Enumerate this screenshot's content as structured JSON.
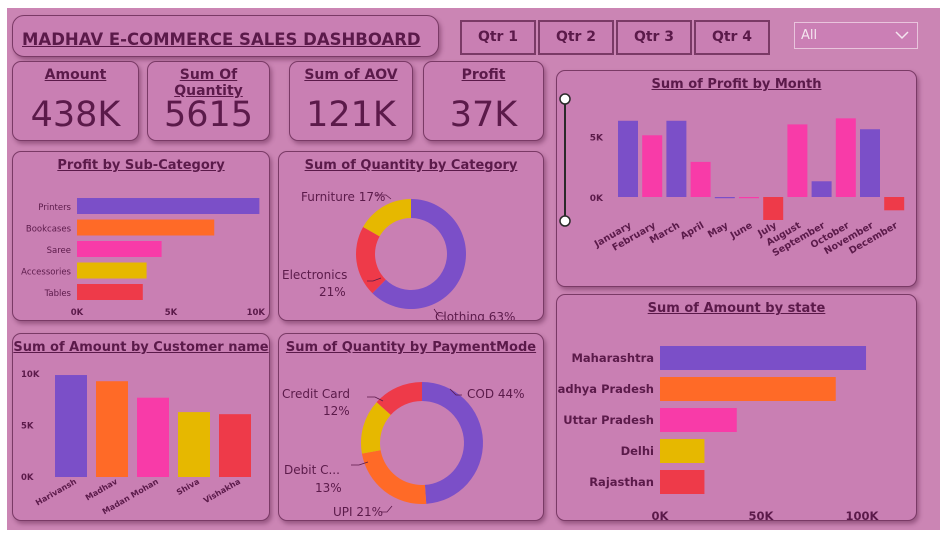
{
  "header": {
    "title": "MADHAV E-COMMERCE SALES DASHBOARD"
  },
  "quarters": [
    "Qtr 1",
    "Qtr 2",
    "Qtr 3",
    "Qtr 4"
  ],
  "filter": {
    "selected": "All"
  },
  "kpis": [
    {
      "label": "Amount",
      "value": "438K"
    },
    {
      "label": "Sum Of Quantity",
      "value": "5615"
    },
    {
      "label": "Sum of AOV",
      "value": "121K"
    },
    {
      "label": "Profit",
      "value": "37K"
    }
  ],
  "colors": {
    "purple": "#7b4fc8",
    "pink": "#f83ba8",
    "orange": "#ff6a27",
    "yellow": "#e6b800",
    "red": "#ee3a49",
    "text": "#5b1a4a"
  },
  "chart_data": [
    {
      "id": "profit_by_subcategory",
      "type": "bar",
      "orientation": "horizontal",
      "title": "Profit by Sub-Category",
      "categories": [
        "Printers",
        "Bookcases",
        "Saree",
        "Accessories",
        "Tables"
      ],
      "values": [
        9700,
        7300,
        4500,
        3700,
        3500
      ],
      "xlim": [
        0,
        10000
      ],
      "ticks": [
        "0K",
        "5K",
        "10K"
      ]
    },
    {
      "id": "quantity_by_category",
      "type": "pie",
      "title": "Sum of Quantity by Category",
      "labels": [
        "Clothing",
        "Electronics",
        "Furniture"
      ],
      "values": [
        63,
        21,
        17
      ],
      "display": [
        "Clothing 63%",
        "Electronics",
        "21%",
        "Furniture 17%"
      ]
    },
    {
      "id": "profit_by_month",
      "type": "bar",
      "title": "Sum of Profit by Month",
      "categories": [
        "January",
        "February",
        "March",
        "April",
        "May",
        "June",
        "July",
        "August",
        "September",
        "October",
        "November",
        "December"
      ],
      "values": [
        6300,
        5100,
        6300,
        2900,
        -100,
        -100,
        -1900,
        6000,
        1300,
        6500,
        5600,
        -1100
      ],
      "ylim": [
        -3000,
        8000
      ],
      "ticks": [
        "5K",
        "0K"
      ]
    },
    {
      "id": "amount_by_customer",
      "type": "bar",
      "title": "Sum of Amount by Customer name",
      "categories": [
        "Harivansh",
        "Madhav",
        "Madan Mohan",
        "Shiva",
        "Vishakha"
      ],
      "values": [
        9900,
        9300,
        7700,
        6300,
        6100
      ],
      "ylim": [
        0,
        10000
      ],
      "ticks": [
        "10K",
        "5K",
        "0K"
      ]
    },
    {
      "id": "quantity_by_paymentmode",
      "type": "pie",
      "title": "Sum of Quantity by PaymentMode",
      "labels": [
        "COD",
        "UPI",
        "Debit Card",
        "Credit Card"
      ],
      "values": [
        44,
        21,
        13,
        12
      ],
      "display": [
        "COD 44%",
        "UPI 21%",
        "Debit C...",
        "13%",
        "Credit Card",
        "12%"
      ]
    },
    {
      "id": "amount_by_state",
      "type": "bar",
      "orientation": "horizontal",
      "title": "Sum of Amount by state",
      "categories": [
        "Maharashtra",
        "Madhya Pradesh",
        "Uttar Pradesh",
        "Delhi",
        "Rajasthan"
      ],
      "values": [
        102000,
        87000,
        38000,
        22000,
        22000
      ],
      "xlim": [
        0,
        100000
      ],
      "ticks": [
        "0K",
        "50K",
        "100K"
      ]
    }
  ]
}
